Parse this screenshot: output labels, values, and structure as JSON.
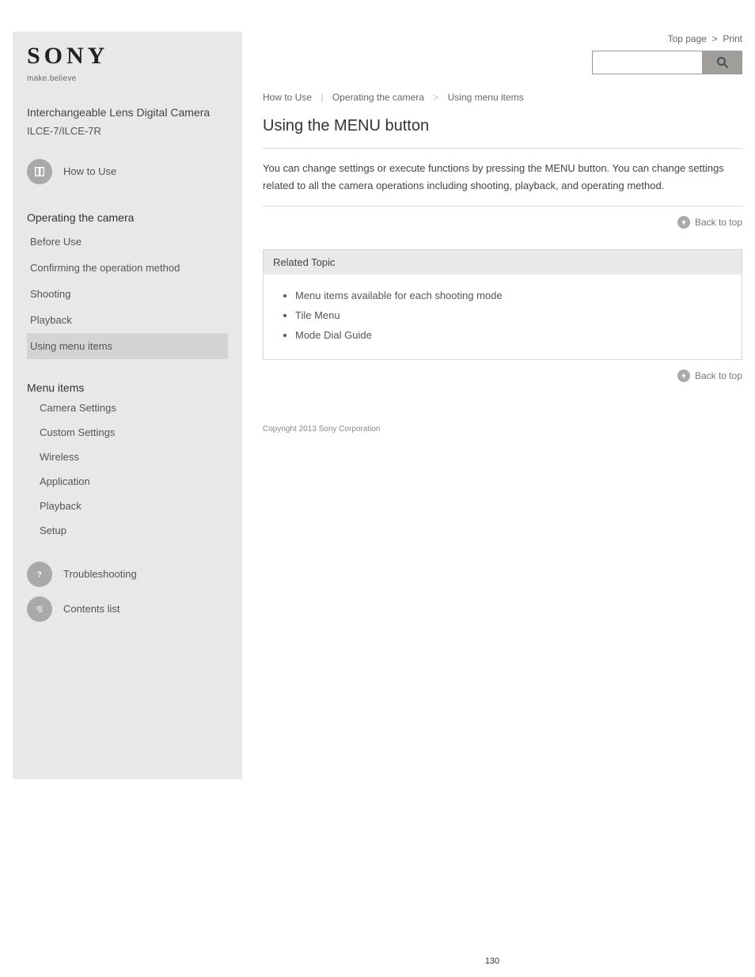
{
  "brand": {
    "name": "SONY",
    "tagline": "make.believe"
  },
  "product": {
    "name": "Interchangeable Lens Digital Camera",
    "model": "ILCE-7/ILCE-7R"
  },
  "sidebar": {
    "howto_link": "How to Use",
    "operation_title": "Operating the camera",
    "operation_items": [
      "Before Use",
      "Confirming the operation method",
      "Shooting",
      "Playback",
      "Using menu items"
    ],
    "active_index": 4,
    "menu_title": "Menu items",
    "menu_items": [
      "Camera Settings",
      "Custom Settings",
      "Wireless",
      "Application",
      "Playback",
      "Setup"
    ],
    "troubleshoot_label": "Troubleshooting",
    "contents_label": "Contents list"
  },
  "top_links": {
    "top": "Top page",
    "print": "Print"
  },
  "search": {
    "placeholder": ""
  },
  "breadcrumb": {
    "item1": "How to Use",
    "item2": "Operating the camera",
    "item3": "Using menu items"
  },
  "content": {
    "title": "Using the MENU button",
    "body": "You can change settings or execute functions by pressing the MENU button. You can change settings related to all the camera operations including shooting, playback, and operating method.",
    "back_to_top": "Back to top"
  },
  "related": {
    "heading": "Related Topic",
    "items": [
      "Menu items available for each shooting mode",
      "Tile Menu",
      "Mode Dial Guide"
    ]
  },
  "copyright": "Copyright 2013 Sony Corporation",
  "page_number": "130"
}
